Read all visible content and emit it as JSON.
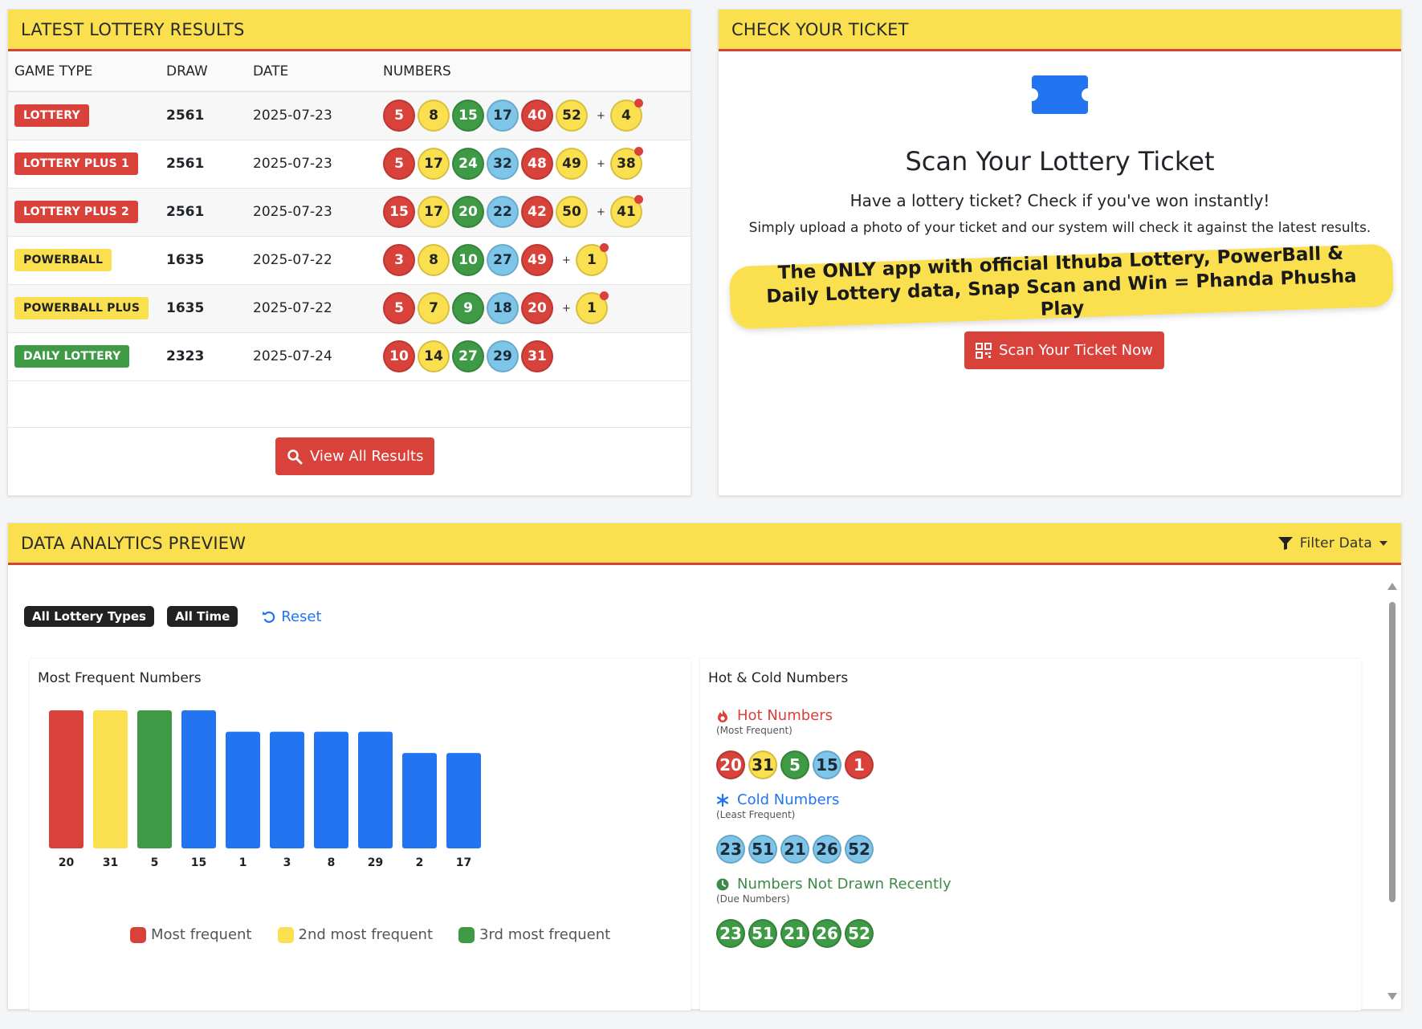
{
  "results": {
    "title": "LATEST LOTTERY RESULTS",
    "columns": [
      "GAME TYPE",
      "DRAW",
      "DATE",
      "NUMBERS"
    ],
    "rows": [
      {
        "game": "LOTTERY",
        "badge": "red",
        "draw": "2561",
        "date": "2025-07-23",
        "balls": [
          [
            "5",
            "red"
          ],
          [
            "8",
            "yel"
          ],
          [
            "15",
            "grn"
          ],
          [
            "17",
            "blu"
          ],
          [
            "40",
            "red"
          ],
          [
            "52",
            "yel"
          ]
        ],
        "bonus": [
          "4",
          "yel"
        ]
      },
      {
        "game": "LOTTERY PLUS 1",
        "badge": "red",
        "draw": "2561",
        "date": "2025-07-23",
        "balls": [
          [
            "5",
            "red"
          ],
          [
            "17",
            "yel"
          ],
          [
            "24",
            "grn"
          ],
          [
            "32",
            "blu"
          ],
          [
            "48",
            "red"
          ],
          [
            "49",
            "yel"
          ]
        ],
        "bonus": [
          "38",
          "yel"
        ]
      },
      {
        "game": "LOTTERY PLUS 2",
        "badge": "red",
        "draw": "2561",
        "date": "2025-07-23",
        "balls": [
          [
            "15",
            "red"
          ],
          [
            "17",
            "yel"
          ],
          [
            "20",
            "grn"
          ],
          [
            "22",
            "blu"
          ],
          [
            "42",
            "red"
          ],
          [
            "50",
            "yel"
          ]
        ],
        "bonus": [
          "41",
          "yel"
        ]
      },
      {
        "game": "POWERBALL",
        "badge": "yellow",
        "draw": "1635",
        "date": "2025-07-22",
        "balls": [
          [
            "3",
            "red"
          ],
          [
            "8",
            "yel"
          ],
          [
            "10",
            "grn"
          ],
          [
            "27",
            "blu"
          ],
          [
            "49",
            "red"
          ]
        ],
        "bonus": [
          "1",
          "yel"
        ]
      },
      {
        "game": "POWERBALL PLUS",
        "badge": "yellow",
        "draw": "1635",
        "date": "2025-07-22",
        "balls": [
          [
            "5",
            "red"
          ],
          [
            "7",
            "yel"
          ],
          [
            "9",
            "grn"
          ],
          [
            "18",
            "blu"
          ],
          [
            "20",
            "red"
          ]
        ],
        "bonus": [
          "1",
          "yel"
        ]
      },
      {
        "game": "DAILY LOTTERY",
        "badge": "green",
        "draw": "2323",
        "date": "2025-07-24",
        "balls": [
          [
            "10",
            "red"
          ],
          [
            "14",
            "yel"
          ],
          [
            "27",
            "grn"
          ],
          [
            "29",
            "blu"
          ],
          [
            "31",
            "red"
          ]
        ],
        "bonus": null
      }
    ],
    "plus_sign": "+",
    "view_all_label": "View All Results"
  },
  "ticket": {
    "title": "CHECK YOUR TICKET",
    "heading": "Scan Your Lottery Ticket",
    "subheading": "Have a lottery ticket? Check if you've won instantly!",
    "description": "Simply upload a photo of your ticket and our system will check it against the latest results.",
    "promo": "The ONLY app with official Ithuba Lottery, PowerBall & Daily Lottery data, Snap Scan and Win = Phanda Phusha Play",
    "scan_label": "Scan Your Ticket Now"
  },
  "analytics": {
    "title": "DATA ANALYTICS PREVIEW",
    "filter_label": "Filter Data",
    "filters": [
      "All Lottery Types",
      "All Time"
    ],
    "reset_label": "Reset",
    "freq_title": "Most Frequent Numbers",
    "hc_title": "Hot & Cold Numbers",
    "hot": {
      "label": "Hot Numbers",
      "sub": "(Most Frequent)",
      "balls": [
        [
          "20",
          "red"
        ],
        [
          "31",
          "yel"
        ],
        [
          "5",
          "grn"
        ],
        [
          "15",
          "blu"
        ],
        [
          "1",
          "red"
        ]
      ]
    },
    "cold": {
      "label": "Cold Numbers",
      "sub": "(Least Frequent)",
      "balls": [
        [
          "23",
          "blu"
        ],
        [
          "51",
          "blu"
        ],
        [
          "21",
          "blu"
        ],
        [
          "26",
          "blu"
        ],
        [
          "52",
          "blu"
        ]
      ]
    },
    "due": {
      "label": "Numbers Not Drawn Recently",
      "sub": "(Due Numbers)",
      "balls": [
        [
          "23",
          "grn"
        ],
        [
          "51",
          "grn"
        ],
        [
          "21",
          "grn"
        ],
        [
          "26",
          "grn"
        ],
        [
          "52",
          "grn"
        ]
      ]
    }
  },
  "colors": {
    "red": "#d9413b",
    "yellow": "#fadf4e",
    "green": "#3e9a45",
    "blue": "#2374f0",
    "ball_blue": "#7ec5ea"
  },
  "chart_data": {
    "type": "bar",
    "categories": [
      "20",
      "31",
      "5",
      "15",
      "1",
      "3",
      "8",
      "29",
      "2",
      "17"
    ],
    "values": [
      7,
      7,
      7,
      7,
      6,
      6,
      6,
      6,
      5,
      5
    ],
    "bar_colors": [
      "#d9413b",
      "#fadf4e",
      "#3e9a45",
      "#2374f0",
      "#2374f0",
      "#2374f0",
      "#2374f0",
      "#2374f0",
      "#2374f0",
      "#2374f0"
    ],
    "legend": [
      {
        "label": "Most frequent",
        "color": "#d9413b"
      },
      {
        "label": "2nd most frequent",
        "color": "#fadf4e"
      },
      {
        "label": "3rd most frequent",
        "color": "#3e9a45"
      }
    ],
    "legend_position": "bottom",
    "grid": false
  }
}
